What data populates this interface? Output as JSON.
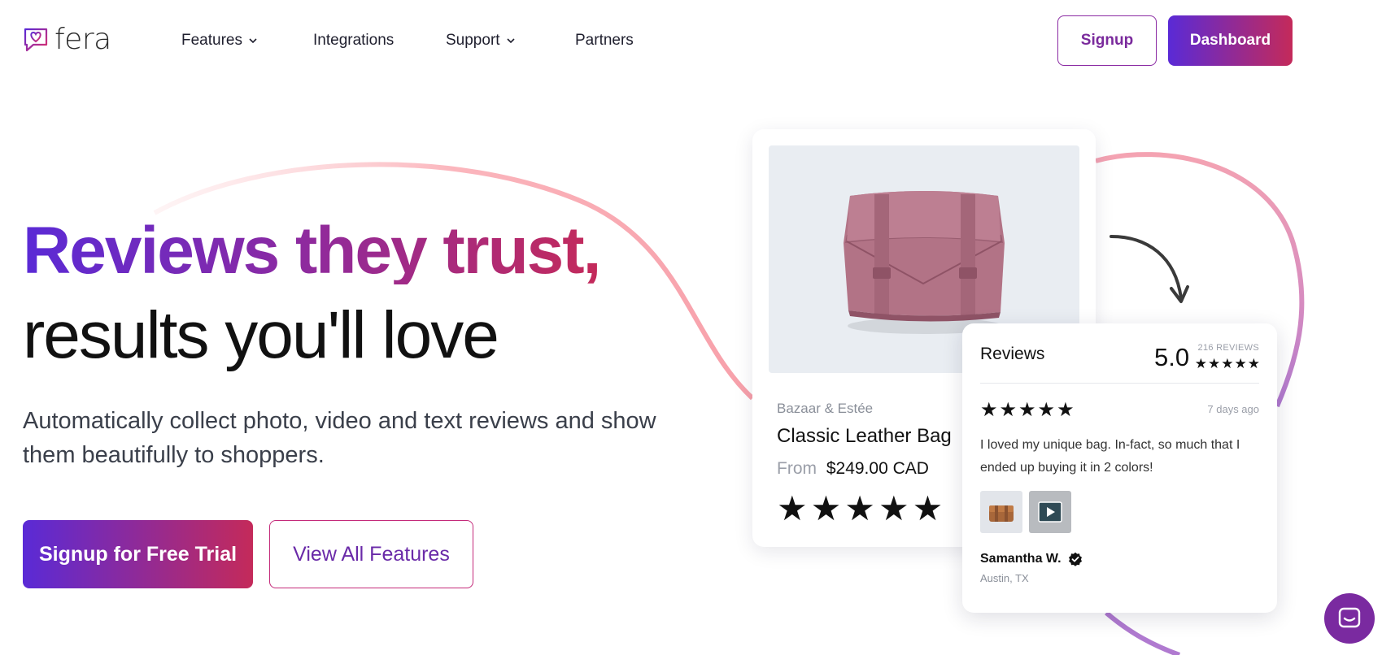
{
  "nav": {
    "logo_text": "fera",
    "items": [
      {
        "label": "Features",
        "has_dropdown": true
      },
      {
        "label": "Integrations",
        "has_dropdown": false
      },
      {
        "label": "Support",
        "has_dropdown": true
      },
      {
        "label": "Partners",
        "has_dropdown": false
      }
    ],
    "signup_label": "Signup",
    "dashboard_label": "Dashboard"
  },
  "hero": {
    "title_line1": "Reviews they trust,",
    "title_line2": "results you'll love",
    "subtitle": "Automatically collect photo, video and text reviews and show them beautifully to shoppers.",
    "primary_cta": "Signup for Free Trial",
    "secondary_cta": "View All Features"
  },
  "product": {
    "brand": "Bazaar & Estée",
    "name": "Classic Leather Bag",
    "price_prefix": "From",
    "price": "$249.00 CAD",
    "stars": "★★★★★",
    "rating": 5
  },
  "reviews": {
    "title": "Reviews",
    "score": "5.0",
    "count_label": "216 REVIEWS",
    "summary_stars": "★★★★★",
    "item": {
      "stars": "★★★★★",
      "date": "7 days ago",
      "text": "I loved my unique bag. In-fact, so much that I ended up buying it in 2 colors!",
      "author": "Samantha W.",
      "location": "Austin, TX",
      "verified": true
    }
  },
  "colors": {
    "gradient_start": "#5a2ad6",
    "gradient_end": "#c42a5a",
    "accent_purple": "#7a2aa0",
    "swoosh_pink": "#f7a8b0"
  },
  "icons": [
    "heart-chat-logo-icon",
    "chevron-down-icon",
    "curved-arrow-icon",
    "verified-badge-icon",
    "play-video-icon",
    "chat-bubble-icon"
  ]
}
